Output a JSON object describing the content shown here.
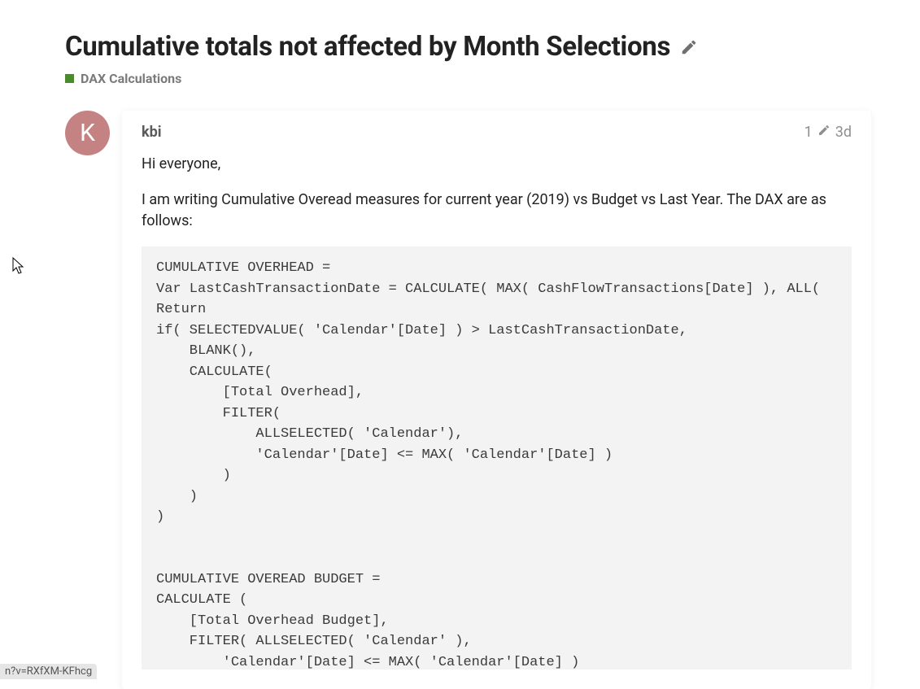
{
  "topic": {
    "title": "Cumulative totals not affected by Month Selections",
    "category_color": "#4a8b2c",
    "category": "DAX Calculations"
  },
  "post": {
    "avatar_letter": "K",
    "author": "kbi",
    "edit_count": "1",
    "age": "3d",
    "greeting": "Hi everyone,",
    "intro": "I am writing Cumulative Overead measures for current year (2019) vs Budget vs Last Year. The DAX are as follows:",
    "code": "CUMULATIVE OVERHEAD =\nVar LastCashTransactionDate = CALCULATE( MAX( CashFlowTransactions[Date] ), ALL( \nReturn\nif( SELECTEDVALUE( 'Calendar'[Date] ) > LastCashTransactionDate,\n    BLANK(),\n    CALCULATE(\n        [Total Overhead],\n        FILTER(\n            ALLSELECTED( 'Calendar'),\n            'Calendar'[Date] <= MAX( 'Calendar'[Date] )\n        )\n    )\n)\n\n\nCUMULATIVE OVEREAD BUDGET =\nCALCULATE (\n    [Total Overhead Budget],\n    FILTER( ALLSELECTED( 'Calendar' ),\n        'Calendar'[Date] <= MAX( 'Calendar'[Date] )\n    )\n)"
  },
  "statusbar": "n?v=RXfXM-KFhcg"
}
